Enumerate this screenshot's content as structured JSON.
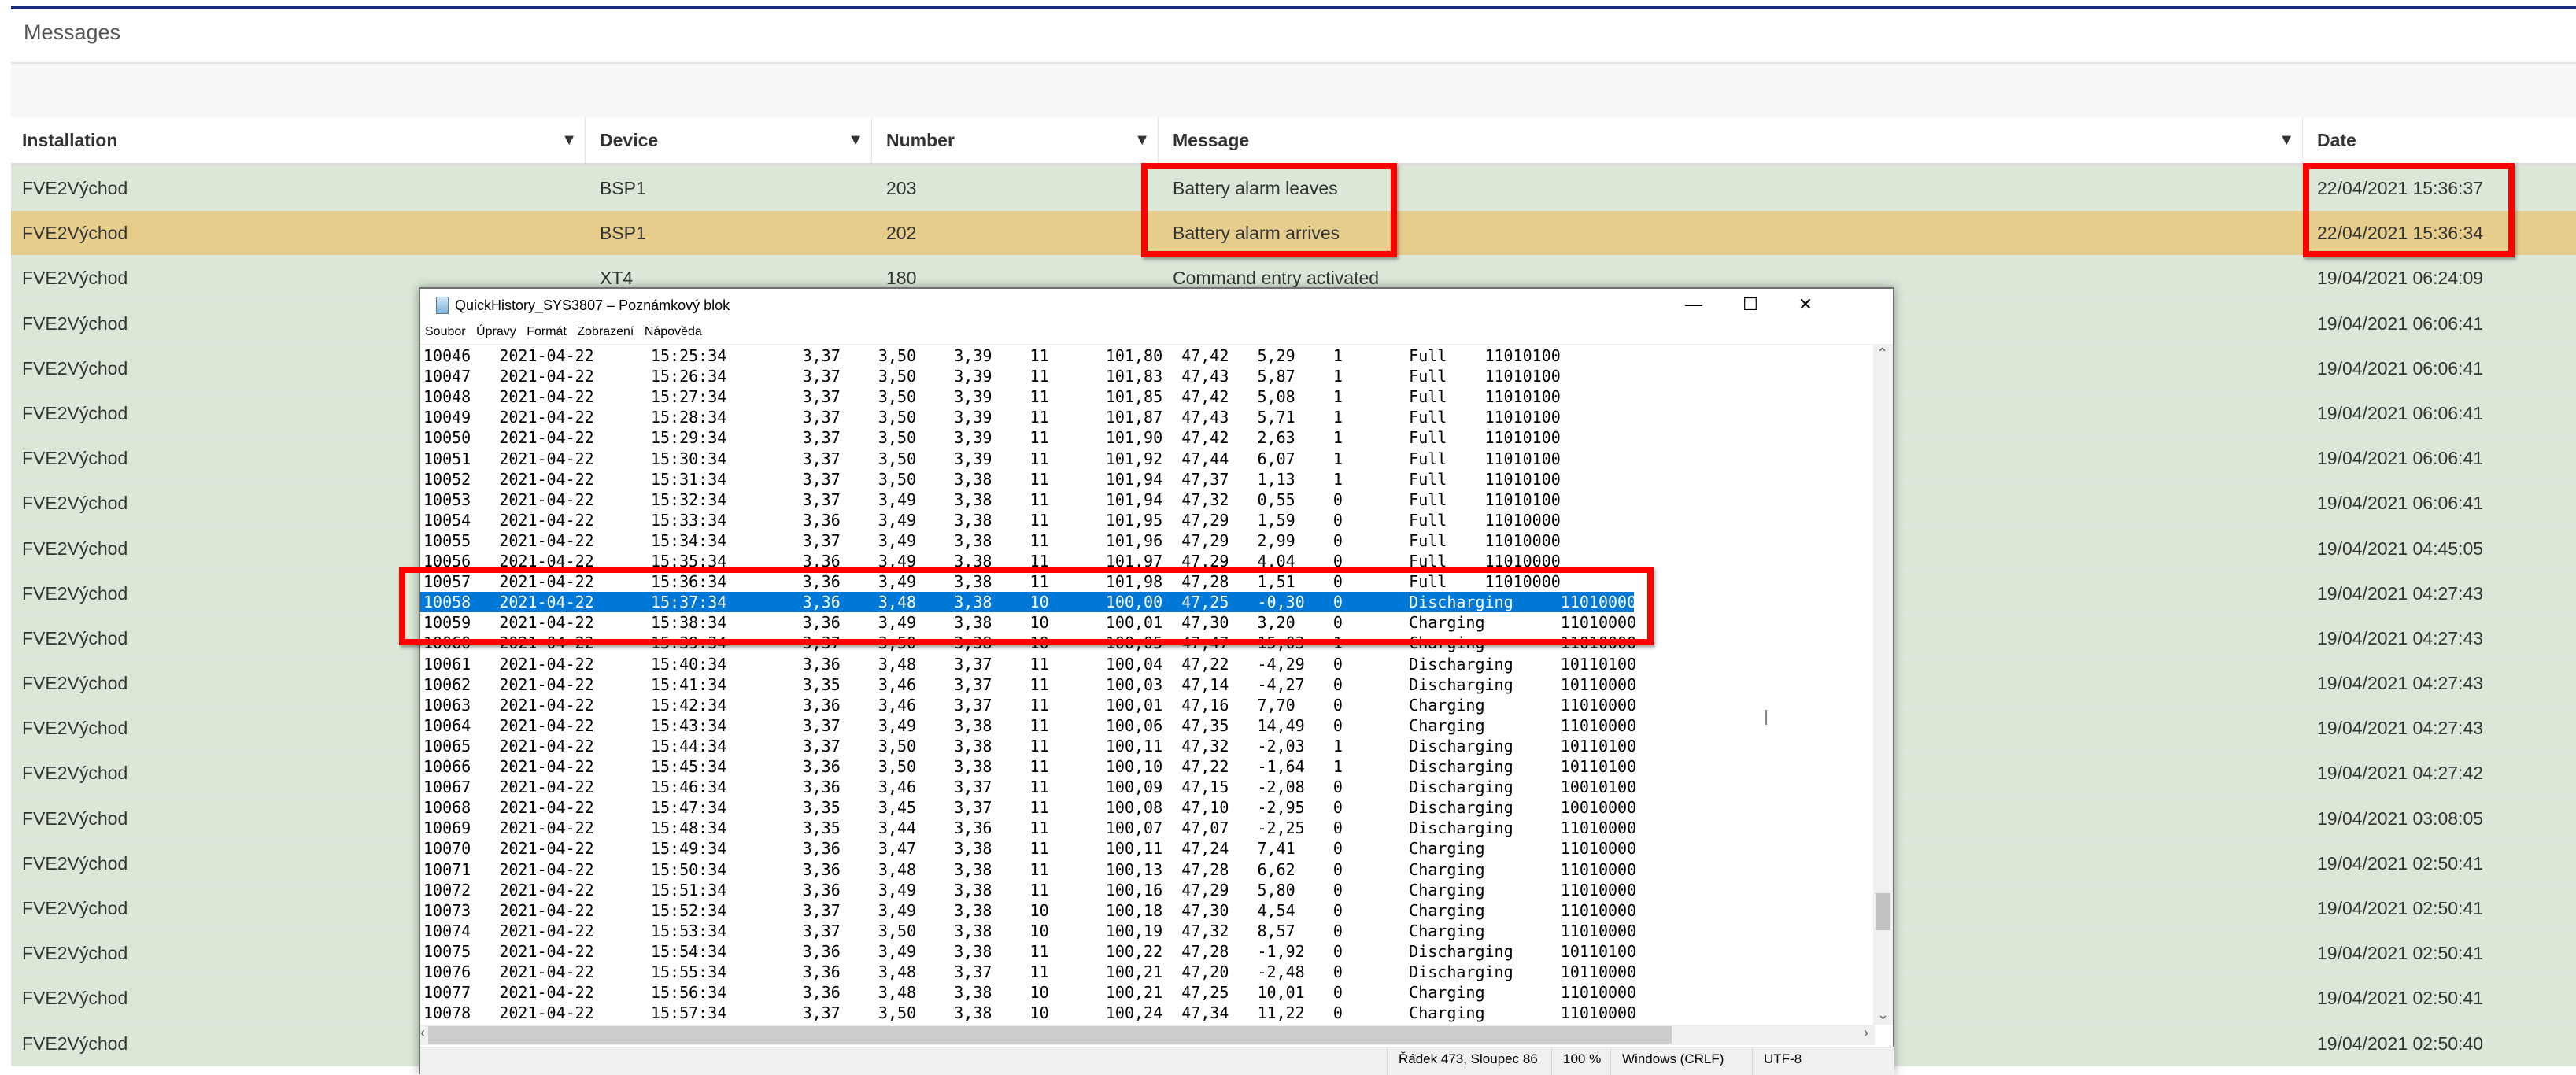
{
  "page": {
    "title": "Messages"
  },
  "colors": {
    "accent_bar": "#1a2a7a",
    "row_green": "#dbe8d8",
    "row_selected": "#e6cd8c",
    "highlight_box": "#ff0000",
    "notepad_selection": "#0078d7"
  },
  "table": {
    "columns": [
      {
        "label": "Installation",
        "filter_icon": "filter-icon"
      },
      {
        "label": "Device",
        "filter_icon": "filter-icon"
      },
      {
        "label": "Number",
        "filter_icon": "filter-icon"
      },
      {
        "label": "Message",
        "filter_icon": "filter-icon"
      },
      {
        "label": "Date"
      }
    ],
    "selected_row": 1,
    "rows": [
      {
        "installation": "FVE2Východ",
        "device": "BSP1",
        "number": "203",
        "message": "Battery alarm leaves",
        "date": "22/04/2021 15:36:37"
      },
      {
        "installation": "FVE2Východ",
        "device": "BSP1",
        "number": "202",
        "message": "Battery alarm arrives",
        "date": "22/04/2021 15:36:34"
      },
      {
        "installation": "FVE2Východ",
        "device": "XT4",
        "number": "180",
        "message": "Command entry activated",
        "date": "19/04/2021 06:24:09"
      },
      {
        "installation": "FVE2Východ",
        "date": "19/04/2021 06:06:41"
      },
      {
        "installation": "FVE2Východ",
        "date": "19/04/2021 06:06:41"
      },
      {
        "installation": "FVE2Východ",
        "date": "19/04/2021 06:06:41"
      },
      {
        "installation": "FVE2Východ",
        "date": "19/04/2021 06:06:41"
      },
      {
        "installation": "FVE2Východ",
        "date": "19/04/2021 06:06:41"
      },
      {
        "installation": "FVE2Východ",
        "date": "19/04/2021 04:45:05"
      },
      {
        "installation": "FVE2Východ",
        "date": "19/04/2021 04:27:43"
      },
      {
        "installation": "FVE2Východ",
        "date": "19/04/2021 04:27:43"
      },
      {
        "installation": "FVE2Východ",
        "date": "19/04/2021 04:27:43"
      },
      {
        "installation": "FVE2Východ",
        "date": "19/04/2021 04:27:43"
      },
      {
        "installation": "FVE2Východ",
        "date": "19/04/2021 04:27:42"
      },
      {
        "installation": "FVE2Východ",
        "date": "19/04/2021 03:08:05"
      },
      {
        "installation": "FVE2Východ",
        "date": "19/04/2021 02:50:41"
      },
      {
        "installation": "FVE2Východ",
        "date": "19/04/2021 02:50:41"
      },
      {
        "installation": "FVE2Východ",
        "date": "19/04/2021 02:50:41"
      },
      {
        "installation": "FVE2Východ",
        "date": "19/04/2021 02:50:41"
      },
      {
        "installation": "FVE2Východ",
        "date": "19/04/2021 02:50:40"
      }
    ]
  },
  "notepad": {
    "title": "QuickHistory_SYS3807 – Poznámkový blok",
    "menu": [
      "Soubor",
      "Úpravy",
      "Formát",
      "Zobrazení",
      "Nápověda"
    ],
    "window_buttons": {
      "minimize": "—",
      "maximize": "☐",
      "close": "✕"
    },
    "selected_line": 12,
    "lines": [
      [
        "10046",
        "2021-04-22",
        "15:25:34",
        "3,37",
        "3,50",
        "3,39",
        "11",
        "101,80",
        "47,42",
        "5,29",
        "1",
        "Full",
        "11010100"
      ],
      [
        "10047",
        "2021-04-22",
        "15:26:34",
        "3,37",
        "3,50",
        "3,39",
        "11",
        "101,83",
        "47,43",
        "5,87",
        "1",
        "Full",
        "11010100"
      ],
      [
        "10048",
        "2021-04-22",
        "15:27:34",
        "3,37",
        "3,50",
        "3,39",
        "11",
        "101,85",
        "47,42",
        "5,08",
        "1",
        "Full",
        "11010100"
      ],
      [
        "10049",
        "2021-04-22",
        "15:28:34",
        "3,37",
        "3,50",
        "3,39",
        "11",
        "101,87",
        "47,43",
        "5,71",
        "1",
        "Full",
        "11010100"
      ],
      [
        "10050",
        "2021-04-22",
        "15:29:34",
        "3,37",
        "3,50",
        "3,39",
        "11",
        "101,90",
        "47,42",
        "2,63",
        "1",
        "Full",
        "11010100"
      ],
      [
        "10051",
        "2021-04-22",
        "15:30:34",
        "3,37",
        "3,50",
        "3,39",
        "11",
        "101,92",
        "47,44",
        "6,07",
        "1",
        "Full",
        "11010100"
      ],
      [
        "10052",
        "2021-04-22",
        "15:31:34",
        "3,37",
        "3,50",
        "3,38",
        "11",
        "101,94",
        "47,37",
        "1,13",
        "1",
        "Full",
        "11010100"
      ],
      [
        "10053",
        "2021-04-22",
        "15:32:34",
        "3,37",
        "3,49",
        "3,38",
        "11",
        "101,94",
        "47,32",
        "0,55",
        "0",
        "Full",
        "11010100"
      ],
      [
        "10054",
        "2021-04-22",
        "15:33:34",
        "3,36",
        "3,49",
        "3,38",
        "11",
        "101,95",
        "47,29",
        "1,59",
        "0",
        "Full",
        "11010000"
      ],
      [
        "10055",
        "2021-04-22",
        "15:34:34",
        "3,37",
        "3,49",
        "3,38",
        "11",
        "101,96",
        "47,29",
        "2,99",
        "0",
        "Full",
        "11010000"
      ],
      [
        "10056",
        "2021-04-22",
        "15:35:34",
        "3,36",
        "3,49",
        "3,38",
        "11",
        "101,97",
        "47,29",
        "4,04",
        "0",
        "Full",
        "11010000"
      ],
      [
        "10057",
        "2021-04-22",
        "15:36:34",
        "3,36",
        "3,49",
        "3,38",
        "11",
        "101,98",
        "47,28",
        "1,51",
        "0",
        "Full",
        "11010000"
      ],
      [
        "10058",
        "2021-04-22",
        "15:37:34",
        "3,36",
        "3,48",
        "3,38",
        "10",
        "100,00",
        "47,25",
        "-0,30",
        "0",
        "Discharging",
        "11010000"
      ],
      [
        "10059",
        "2021-04-22",
        "15:38:34",
        "3,36",
        "3,49",
        "3,38",
        "10",
        "100,01",
        "47,30",
        "3,20",
        "0",
        "Charging",
        "11010000"
      ],
      [
        "10060",
        "2021-04-22",
        "15:39:34",
        "3,37",
        "3,50",
        "3,38",
        "10",
        "100,05",
        "47,47",
        "15,03",
        "1",
        "Charging",
        "11010000"
      ],
      [
        "10061",
        "2021-04-22",
        "15:40:34",
        "3,36",
        "3,48",
        "3,37",
        "11",
        "100,04",
        "47,22",
        "-4,29",
        "0",
        "Discharging",
        "10110100"
      ],
      [
        "10062",
        "2021-04-22",
        "15:41:34",
        "3,35",
        "3,46",
        "3,37",
        "11",
        "100,03",
        "47,14",
        "-4,27",
        "0",
        "Discharging",
        "10110000"
      ],
      [
        "10063",
        "2021-04-22",
        "15:42:34",
        "3,36",
        "3,46",
        "3,37",
        "11",
        "100,01",
        "47,16",
        "7,70",
        "0",
        "Charging",
        "11010000"
      ],
      [
        "10064",
        "2021-04-22",
        "15:43:34",
        "3,37",
        "3,49",
        "3,38",
        "11",
        "100,06",
        "47,35",
        "14,49",
        "0",
        "Charging",
        "11010000"
      ],
      [
        "10065",
        "2021-04-22",
        "15:44:34",
        "3,37",
        "3,50",
        "3,38",
        "11",
        "100,11",
        "47,32",
        "-2,03",
        "1",
        "Discharging",
        "10110100"
      ],
      [
        "10066",
        "2021-04-22",
        "15:45:34",
        "3,36",
        "3,50",
        "3,38",
        "11",
        "100,10",
        "47,22",
        "-1,64",
        "1",
        "Discharging",
        "10110100"
      ],
      [
        "10067",
        "2021-04-22",
        "15:46:34",
        "3,36",
        "3,46",
        "3,37",
        "11",
        "100,09",
        "47,15",
        "-2,08",
        "0",
        "Discharging",
        "10010100"
      ],
      [
        "10068",
        "2021-04-22",
        "15:47:34",
        "3,35",
        "3,45",
        "3,37",
        "11",
        "100,08",
        "47,10",
        "-2,95",
        "0",
        "Discharging",
        "10010000"
      ],
      [
        "10069",
        "2021-04-22",
        "15:48:34",
        "3,35",
        "3,44",
        "3,36",
        "11",
        "100,07",
        "47,07",
        "-2,25",
        "0",
        "Discharging",
        "11010000"
      ],
      [
        "10070",
        "2021-04-22",
        "15:49:34",
        "3,36",
        "3,47",
        "3,38",
        "11",
        "100,11",
        "47,24",
        "7,41",
        "0",
        "Charging",
        "11010000"
      ],
      [
        "10071",
        "2021-04-22",
        "15:50:34",
        "3,36",
        "3,48",
        "3,38",
        "11",
        "100,13",
        "47,28",
        "6,62",
        "0",
        "Charging",
        "11010000"
      ],
      [
        "10072",
        "2021-04-22",
        "15:51:34",
        "3,36",
        "3,49",
        "3,38",
        "11",
        "100,16",
        "47,29",
        "5,80",
        "0",
        "Charging",
        "11010000"
      ],
      [
        "10073",
        "2021-04-22",
        "15:52:34",
        "3,37",
        "3,49",
        "3,38",
        "10",
        "100,18",
        "47,30",
        "4,54",
        "0",
        "Charging",
        "11010000"
      ],
      [
        "10074",
        "2021-04-22",
        "15:53:34",
        "3,37",
        "3,50",
        "3,38",
        "10",
        "100,19",
        "47,32",
        "8,57",
        "0",
        "Charging",
        "11010000"
      ],
      [
        "10075",
        "2021-04-22",
        "15:54:34",
        "3,36",
        "3,49",
        "3,38",
        "11",
        "100,22",
        "47,28",
        "-1,92",
        "0",
        "Discharging",
        "10110100"
      ],
      [
        "10076",
        "2021-04-22",
        "15:55:34",
        "3,36",
        "3,48",
        "3,37",
        "11",
        "100,21",
        "47,20",
        "-2,48",
        "0",
        "Discharging",
        "10110000"
      ],
      [
        "10077",
        "2021-04-22",
        "15:56:34",
        "3,36",
        "3,48",
        "3,38",
        "10",
        "100,21",
        "47,25",
        "10,01",
        "0",
        "Charging",
        "11010000"
      ],
      [
        "10078",
        "2021-04-22",
        "15:57:34",
        "3,37",
        "3,50",
        "3,38",
        "10",
        "100,24",
        "47,34",
        "11,22",
        "0",
        "Charging",
        "11010000"
      ]
    ],
    "status": {
      "position": "Řádek 473, Sloupec 86",
      "zoom": "100 %",
      "line_endings": "Windows (CRLF)",
      "encoding": "UTF-8"
    }
  }
}
